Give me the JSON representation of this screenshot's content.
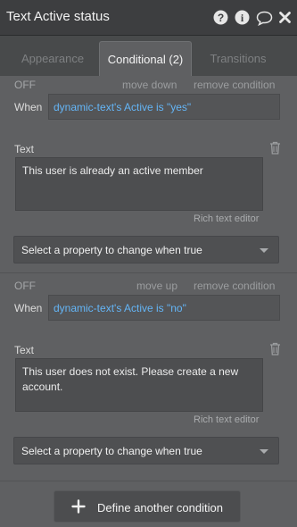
{
  "panel": {
    "title": "Text Active status",
    "icons": [
      "help-icon",
      "info-icon",
      "comment-icon",
      "close-icon"
    ]
  },
  "tabs": [
    {
      "label": "Appearance",
      "active": false
    },
    {
      "label": "Conditional (2)",
      "active": true
    },
    {
      "label": "Transitions",
      "active": false
    }
  ],
  "conditions": [
    {
      "status": "OFF",
      "move_label": "move down",
      "remove_label": "remove condition",
      "when_label": "When",
      "expression": "dynamic-text's Active is \"yes\"",
      "property_label": "Text",
      "property_value": "This user is already an active member",
      "rich_editor_label": "Rich text editor",
      "select_placeholder": "Select a property to change when true"
    },
    {
      "status": "OFF",
      "move_label": "move up",
      "remove_label": "remove condition",
      "when_label": "When",
      "expression": "dynamic-text's Active is \"no\"",
      "property_label": "Text",
      "property_value": "This user does not exist. Please create a new account.",
      "rich_editor_label": "Rich text editor",
      "select_placeholder": "Select a property to change when true"
    }
  ],
  "footer": {
    "add_condition_label": "Define another condition"
  }
}
